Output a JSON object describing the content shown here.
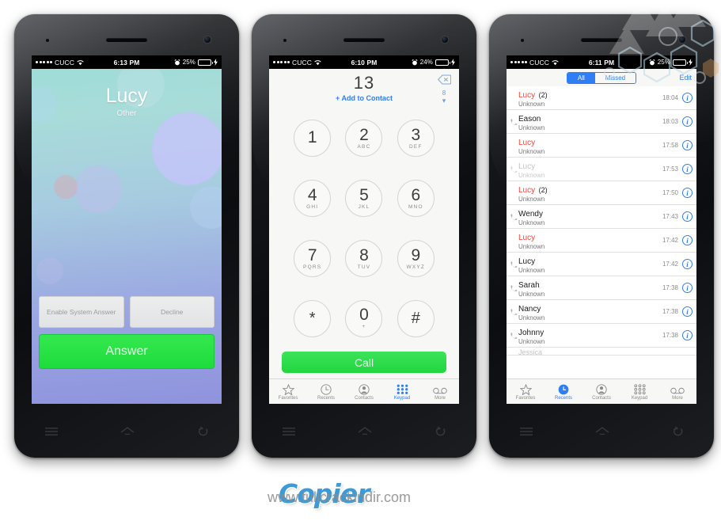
{
  "phones": [
    {
      "id": "incoming-call",
      "status_bar": {
        "carrier": "CUCC",
        "time": "6:13 PM",
        "battery_pct": "25%",
        "signal_dots": 5
      },
      "screen": {
        "caller_name": "Lucy",
        "caller_label": "Other",
        "buttons": {
          "enable_system_answer": "Enable System Answer",
          "decline": "Decline",
          "answer": "Answer"
        }
      }
    },
    {
      "id": "keypad",
      "status_bar": {
        "carrier": "CUCC",
        "time": "6:10 PM",
        "battery_pct": "24%",
        "signal_dots": 5
      },
      "screen": {
        "dialed_number": "13",
        "add_to_contact": "+ Add to Contact",
        "delete_icon": "backspace-icon",
        "suggestion_count": "8",
        "call_button": "Call",
        "keys": [
          {
            "digit": "1",
            "letters": ""
          },
          {
            "digit": "2",
            "letters": "ABC"
          },
          {
            "digit": "3",
            "letters": "DEF"
          },
          {
            "digit": "4",
            "letters": "GHI"
          },
          {
            "digit": "5",
            "letters": "JKL"
          },
          {
            "digit": "6",
            "letters": "MNO"
          },
          {
            "digit": "7",
            "letters": "PQRS"
          },
          {
            "digit": "8",
            "letters": "TUV"
          },
          {
            "digit": "9",
            "letters": "WXYZ"
          },
          {
            "digit": "*",
            "letters": ""
          },
          {
            "digit": "0",
            "letters": "+"
          },
          {
            "digit": "#",
            "letters": ""
          }
        ]
      },
      "tabs": [
        {
          "label": "Favorites",
          "icon": "star-icon",
          "active": false
        },
        {
          "label": "Recents",
          "icon": "clock-icon",
          "active": false
        },
        {
          "label": "Contacts",
          "icon": "person-icon",
          "active": false
        },
        {
          "label": "Keypad",
          "icon": "keypad-icon",
          "active": true
        },
        {
          "label": "More",
          "icon": "voicemail-icon",
          "active": false
        }
      ]
    },
    {
      "id": "recents",
      "status_bar": {
        "carrier": "CUCC",
        "time": "6:11 PM",
        "battery_pct": "25%",
        "signal_dots": 5
      },
      "screen": {
        "segments": [
          {
            "label": "All",
            "selected": true
          },
          {
            "label": "Missed",
            "selected": false
          }
        ],
        "edit_label": "Edit",
        "calls": [
          {
            "name": "Lucy",
            "count": "(2)",
            "sub": "Unknown",
            "time": "18:04",
            "missed": true,
            "faded": false,
            "outgoing": false
          },
          {
            "name": "Eason",
            "count": "",
            "sub": "Unknown",
            "time": "18:03",
            "missed": false,
            "faded": false,
            "outgoing": true
          },
          {
            "name": "Lucy",
            "count": "",
            "sub": "Unknown",
            "time": "17:58",
            "missed": true,
            "faded": false,
            "outgoing": false
          },
          {
            "name": "Lucy",
            "count": "",
            "sub": "Unknown",
            "time": "17:53",
            "missed": false,
            "faded": true,
            "outgoing": true
          },
          {
            "name": "Lucy",
            "count": "(2)",
            "sub": "Unknown",
            "time": "17:50",
            "missed": true,
            "faded": false,
            "outgoing": false
          },
          {
            "name": "Wendy",
            "count": "",
            "sub": "Unknown",
            "time": "17:43",
            "missed": false,
            "faded": false,
            "outgoing": true
          },
          {
            "name": "Lucy",
            "count": "",
            "sub": "Unknown",
            "time": "17:42",
            "missed": true,
            "faded": false,
            "outgoing": false
          },
          {
            "name": "Lucy",
            "count": "",
            "sub": "Unknown",
            "time": "17:42",
            "missed": false,
            "faded": false,
            "outgoing": true
          },
          {
            "name": "Sarah",
            "count": "",
            "sub": "Unknown",
            "time": "17:38",
            "missed": false,
            "faded": false,
            "outgoing": true
          },
          {
            "name": "Nancy",
            "count": "",
            "sub": "Unknown",
            "time": "17:38",
            "missed": false,
            "faded": false,
            "outgoing": true
          },
          {
            "name": "Johnny",
            "count": "",
            "sub": "Unknown",
            "time": "17:38",
            "missed": false,
            "faded": false,
            "outgoing": true
          },
          {
            "name": "Jessica",
            "count": "",
            "sub": "",
            "time": "",
            "missed": false,
            "faded": true,
            "outgoing": false
          }
        ]
      },
      "tabs": [
        {
          "label": "Favorites",
          "icon": "star-icon",
          "active": false
        },
        {
          "label": "Recents",
          "icon": "clock-icon",
          "active": true
        },
        {
          "label": "Contacts",
          "icon": "person-icon",
          "active": false
        },
        {
          "label": "Keypad",
          "icon": "keypad-icon",
          "active": false
        },
        {
          "label": "More",
          "icon": "voicemail-icon",
          "active": false
        }
      ]
    }
  ],
  "watermarks": {
    "logo": "Copier",
    "url": "www.fullcrackindir.com"
  },
  "colors": {
    "ios_blue": "#2f7ef6",
    "call_green": "#21d63f",
    "missed_red": "#f2453d",
    "battery_green": "#4cd964"
  }
}
